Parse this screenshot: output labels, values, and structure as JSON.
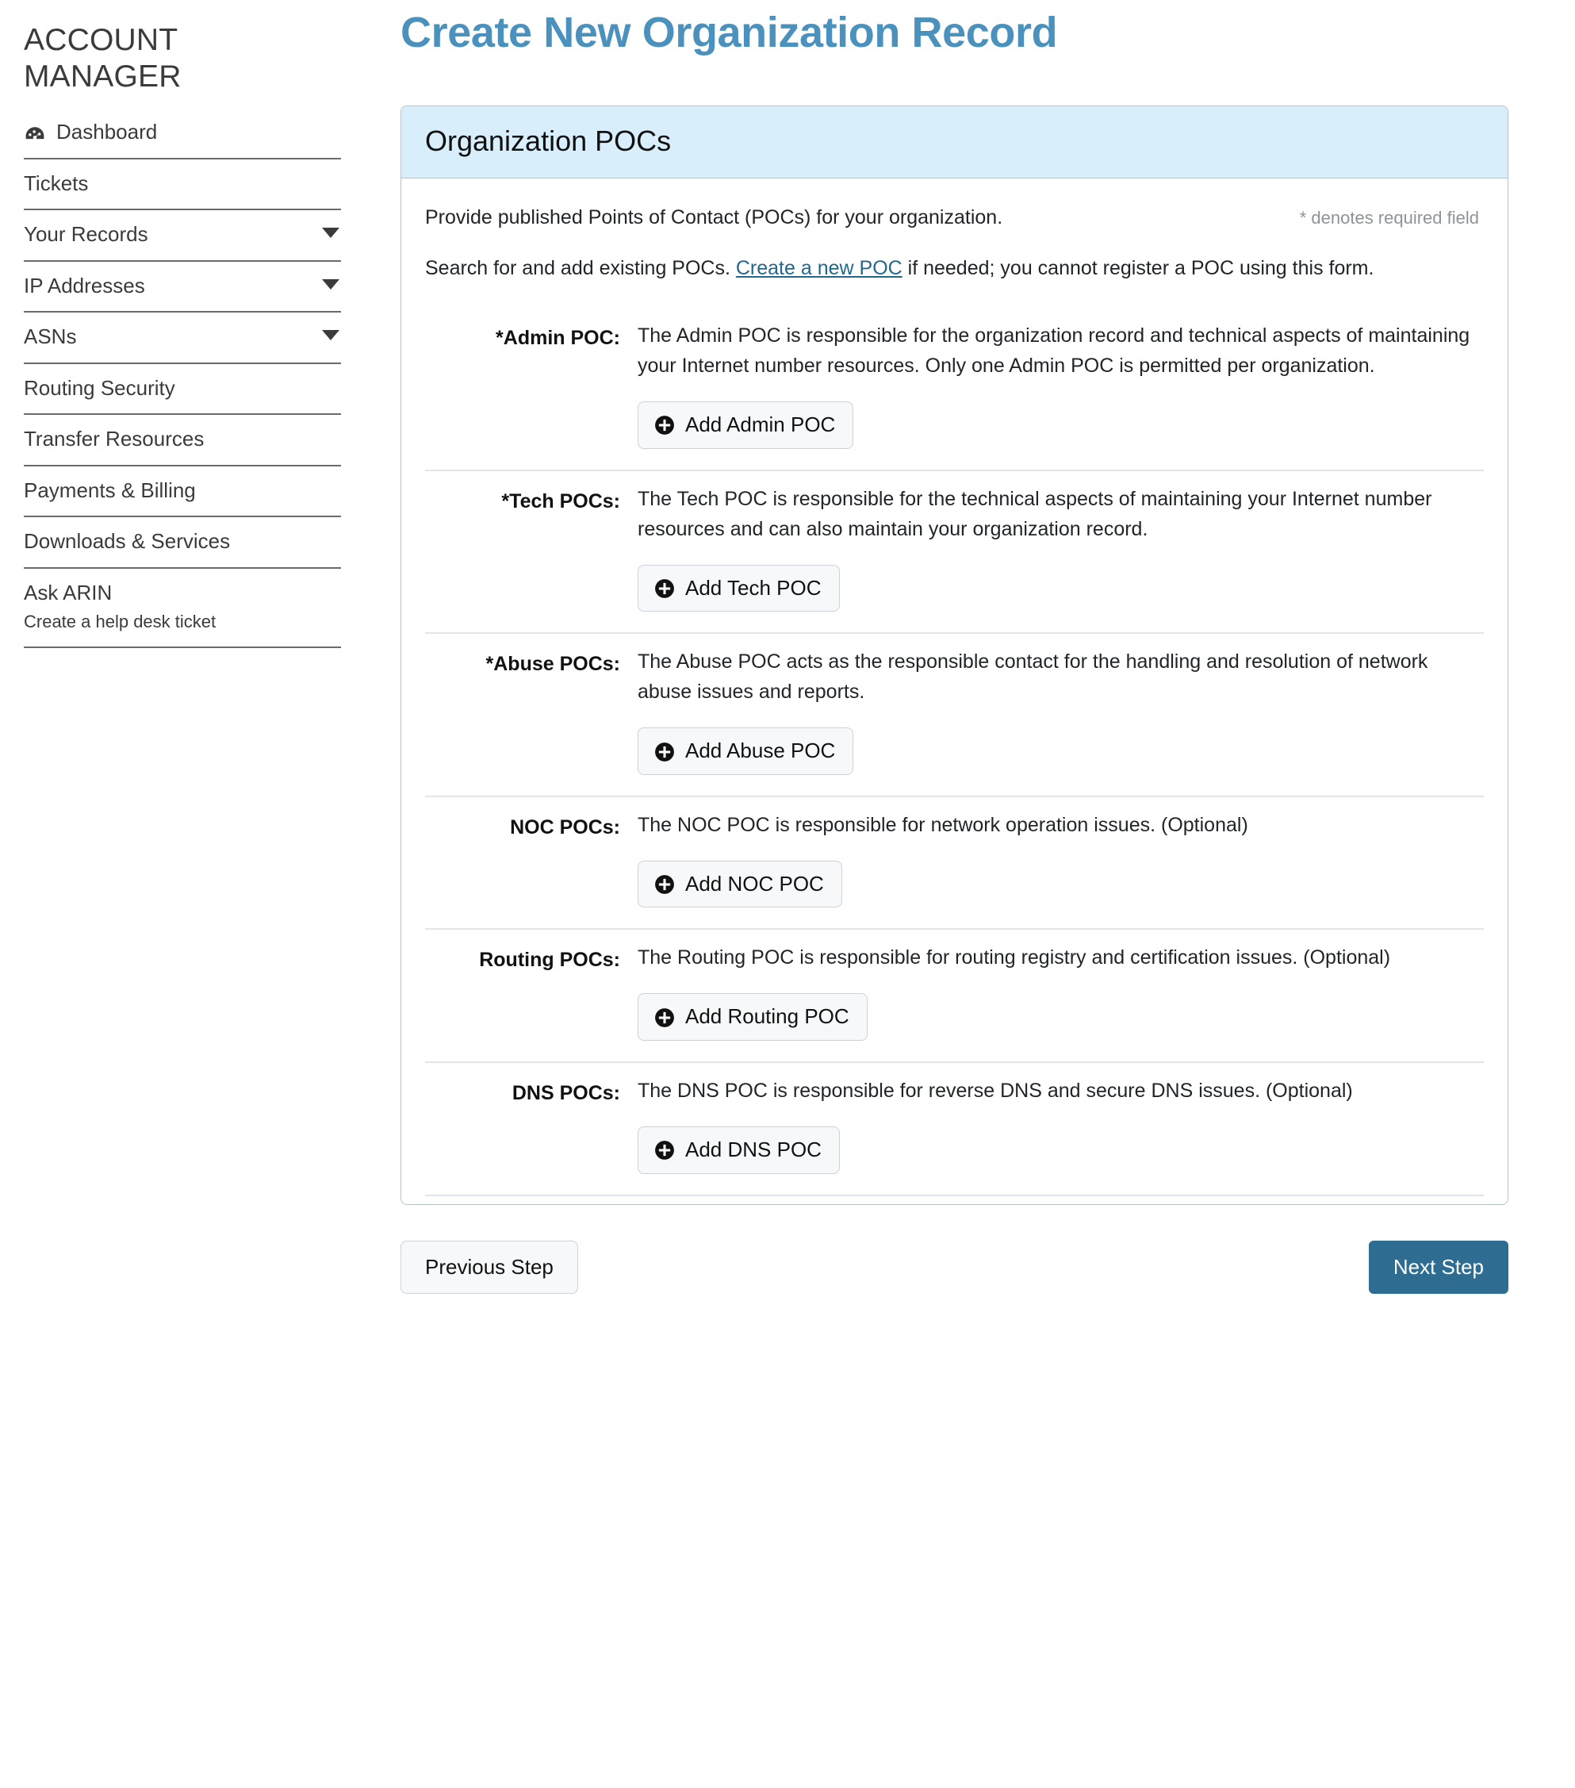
{
  "sidebar": {
    "brand": "ACCOUNT MANAGER",
    "items": [
      {
        "label": "Dashboard",
        "icon": "gauge-icon",
        "caret": false,
        "sub": null
      },
      {
        "label": "Tickets",
        "icon": null,
        "caret": false,
        "sub": null
      },
      {
        "label": "Your Records",
        "icon": null,
        "caret": true,
        "sub": null
      },
      {
        "label": "IP Addresses",
        "icon": null,
        "caret": true,
        "sub": null
      },
      {
        "label": "ASNs",
        "icon": null,
        "caret": true,
        "sub": null
      },
      {
        "label": "Routing Security",
        "icon": null,
        "caret": false,
        "sub": null
      },
      {
        "label": "Transfer Resources",
        "icon": null,
        "caret": false,
        "sub": null
      },
      {
        "label": "Payments & Billing",
        "icon": null,
        "caret": false,
        "sub": null
      },
      {
        "label": "Downloads & Services",
        "icon": null,
        "caret": false,
        "sub": null
      },
      {
        "label": "Ask ARIN",
        "icon": null,
        "caret": false,
        "sub": "Create a help desk ticket"
      }
    ]
  },
  "main": {
    "page_title": "Create New Organization Record",
    "panel": {
      "header": "Organization POCs",
      "intro_line1": "Provide published Points of Contact (POCs) for your organization.",
      "required_note": "* denotes required field",
      "intro_line2_before": "Search for and add existing POCs. ",
      "intro_line2_link": "Create a new POC",
      "intro_line2_after": " if needed; you cannot register a POC using this form.",
      "rows": [
        {
          "label": "*Admin POC:",
          "description": "The Admin POC is responsible for the organization record and technical aspects of maintaining your Internet number resources. Only one Admin POC is permitted per organization.",
          "button": "Add Admin POC",
          "button_icon": "plus-circle-icon"
        },
        {
          "label": "*Tech POCs:",
          "description": "The Tech POC is responsible for the technical aspects of maintaining your Internet number resources and can also maintain your organization record.",
          "button": "Add Tech POC",
          "button_icon": "plus-circle-icon"
        },
        {
          "label": "*Abuse POCs:",
          "description": "The Abuse POC acts as the responsible contact for the handling and resolution of network abuse issues and reports.",
          "button": "Add Abuse POC",
          "button_icon": "plus-circle-icon"
        },
        {
          "label": "NOC POCs:",
          "description": "The NOC POC is responsible for network operation issues. (Optional)",
          "button": "Add NOC POC",
          "button_icon": "plus-circle-icon"
        },
        {
          "label": "Routing POCs:",
          "description": "The Routing POC is responsible for routing registry and certification issues. (Optional)",
          "button": "Add Routing POC",
          "button_icon": "plus-circle-icon"
        },
        {
          "label": "DNS POCs:",
          "description": "The DNS POC is responsible for reverse DNS and secure DNS issues. (Optional)",
          "button": "Add DNS POC",
          "button_icon": "plus-circle-icon"
        }
      ]
    },
    "footer": {
      "previous": "Previous Step",
      "next": "Next Step"
    }
  },
  "colors": {
    "page_title": "#4a91bd",
    "panel_header_bg": "#d9eefb",
    "link": "#23688c",
    "next_button_bg": "#2e6d91",
    "required_note": "#8d9499"
  }
}
